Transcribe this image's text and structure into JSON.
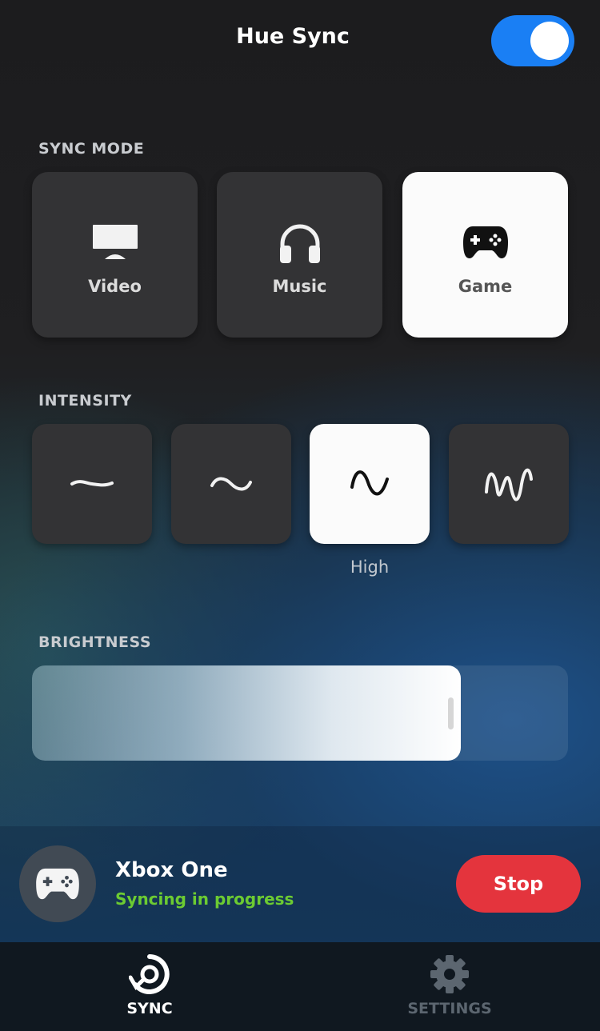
{
  "header": {
    "title": "Hue Sync",
    "sync_enabled": true,
    "toggle_color": "#1a7ff4"
  },
  "sync_mode": {
    "label": "SYNC MODE",
    "options": [
      {
        "label": "Video",
        "icon": "monitor-icon",
        "selected": false
      },
      {
        "label": "Music",
        "icon": "headphones-icon",
        "selected": false
      },
      {
        "label": "Game",
        "icon": "gamepad-icon",
        "selected": true
      }
    ]
  },
  "intensity": {
    "label": "INTENSITY",
    "options": [
      {
        "icon": "wave-subtle-icon",
        "selected": false
      },
      {
        "icon": "wave-moderate-icon",
        "selected": false
      },
      {
        "icon": "wave-high-icon",
        "selected": true
      },
      {
        "icon": "wave-extreme-icon",
        "selected": false
      }
    ],
    "selected_label": "High"
  },
  "brightness": {
    "label": "BRIGHTNESS",
    "level_fraction": 0.8
  },
  "now_playing": {
    "device": "Xbox One",
    "status": "Syncing in progress",
    "status_color": "#6ccb32",
    "stop_label": "Stop",
    "stop_color": "#e4343d",
    "icon": "gamepad-icon"
  },
  "tabs": [
    {
      "label": "SYNC",
      "icon": "sync-icon",
      "active": true,
      "color": "#ffffff"
    },
    {
      "label": "SETTINGS",
      "icon": "gear-icon",
      "active": false,
      "color": "#5c6670"
    }
  ]
}
